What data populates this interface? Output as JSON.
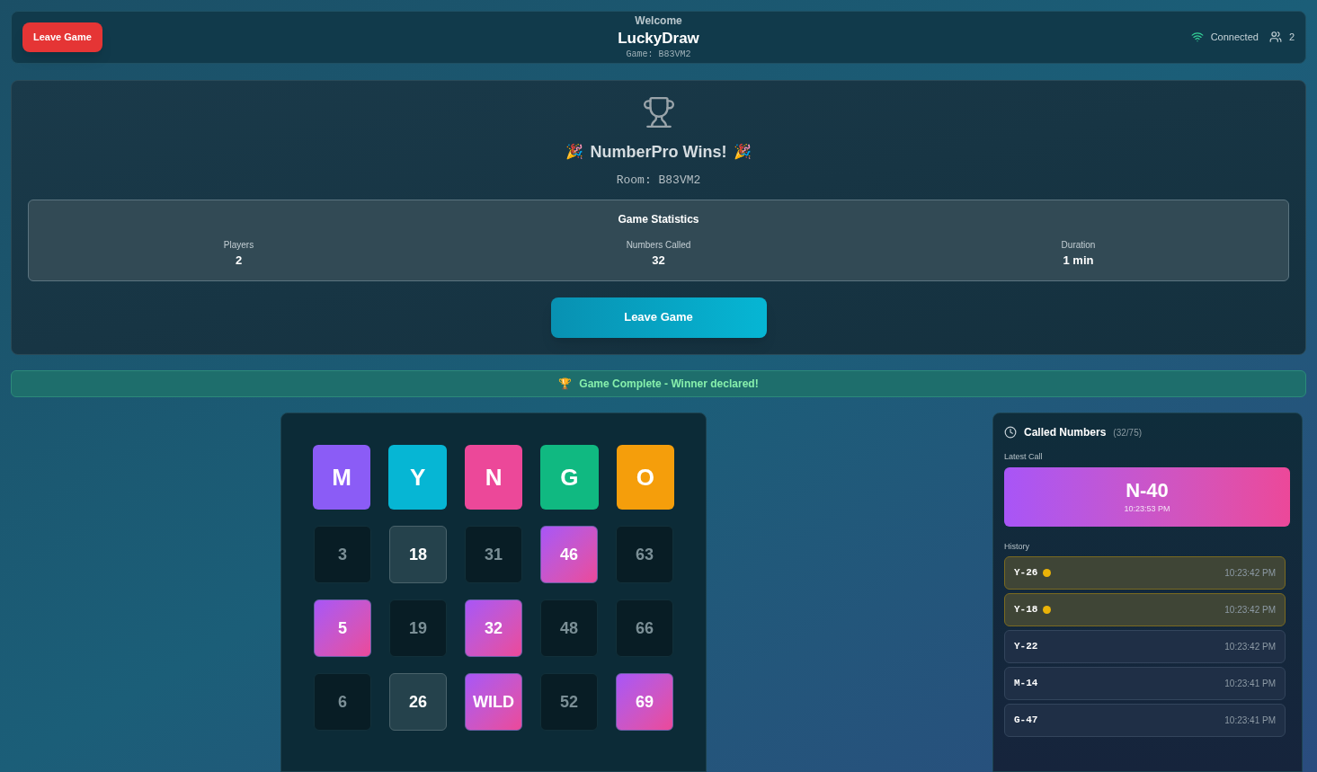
{
  "header": {
    "leave_button": "Leave Game",
    "welcome": "Welcome",
    "player_name": "LuckyDraw",
    "game_code": "Game: B83VM2",
    "status": "Connected",
    "connected": true,
    "player_count": "2"
  },
  "winner": {
    "confetti_left": "🎉",
    "title": "NumberPro Wins!",
    "confetti_right": "🎉",
    "room": "Room: B83VM2",
    "stats": {
      "title": "Game Statistics",
      "items": [
        {
          "label": "Players",
          "value": "2"
        },
        {
          "label": "Numbers Called",
          "value": "32"
        },
        {
          "label": "Duration",
          "value": "1 min"
        }
      ]
    },
    "leave_button": "Leave Game"
  },
  "banner": {
    "icon": "🏆",
    "text": "Game Complete - Winner declared!"
  },
  "board": {
    "columns": [
      {
        "letter": "M",
        "color": "#8b5cf6"
      },
      {
        "letter": "Y",
        "color": "#06b6d4"
      },
      {
        "letter": "N",
        "color": "#ec4899"
      },
      {
        "letter": "G",
        "color": "#10b981"
      },
      {
        "letter": "O",
        "color": "#f59e0b"
      }
    ],
    "rows": [
      [
        {
          "value": "3",
          "kind": "plain"
        },
        {
          "value": "18",
          "kind": "called"
        },
        {
          "value": "31",
          "kind": "plain"
        },
        {
          "value": "46",
          "kind": "marked"
        },
        {
          "value": "63",
          "kind": "plain"
        }
      ],
      [
        {
          "value": "5",
          "kind": "marked"
        },
        {
          "value": "19",
          "kind": "plain"
        },
        {
          "value": "32",
          "kind": "marked"
        },
        {
          "value": "48",
          "kind": "plain"
        },
        {
          "value": "66",
          "kind": "plain"
        }
      ],
      [
        {
          "value": "6",
          "kind": "plain"
        },
        {
          "value": "26",
          "kind": "called"
        },
        {
          "value": "WILD",
          "kind": "marked"
        },
        {
          "value": "52",
          "kind": "plain"
        },
        {
          "value": "69",
          "kind": "marked"
        }
      ]
    ]
  },
  "called_numbers": {
    "title": "Called Numbers",
    "count": "(32/75)",
    "latest_label": "Latest Call",
    "latest": {
      "number": "N-40",
      "time": "10:23:53 PM"
    },
    "history_label": "History",
    "history": [
      {
        "number": "Y-26",
        "time": "10:23:42 PM",
        "highlighted": true
      },
      {
        "number": "Y-18",
        "time": "10:23:42 PM",
        "highlighted": true
      },
      {
        "number": "Y-22",
        "time": "10:23:42 PM",
        "highlighted": false
      },
      {
        "number": "M-14",
        "time": "10:23:41 PM",
        "highlighted": false
      },
      {
        "number": "G-47",
        "time": "10:23:41 PM",
        "highlighted": false
      }
    ]
  }
}
